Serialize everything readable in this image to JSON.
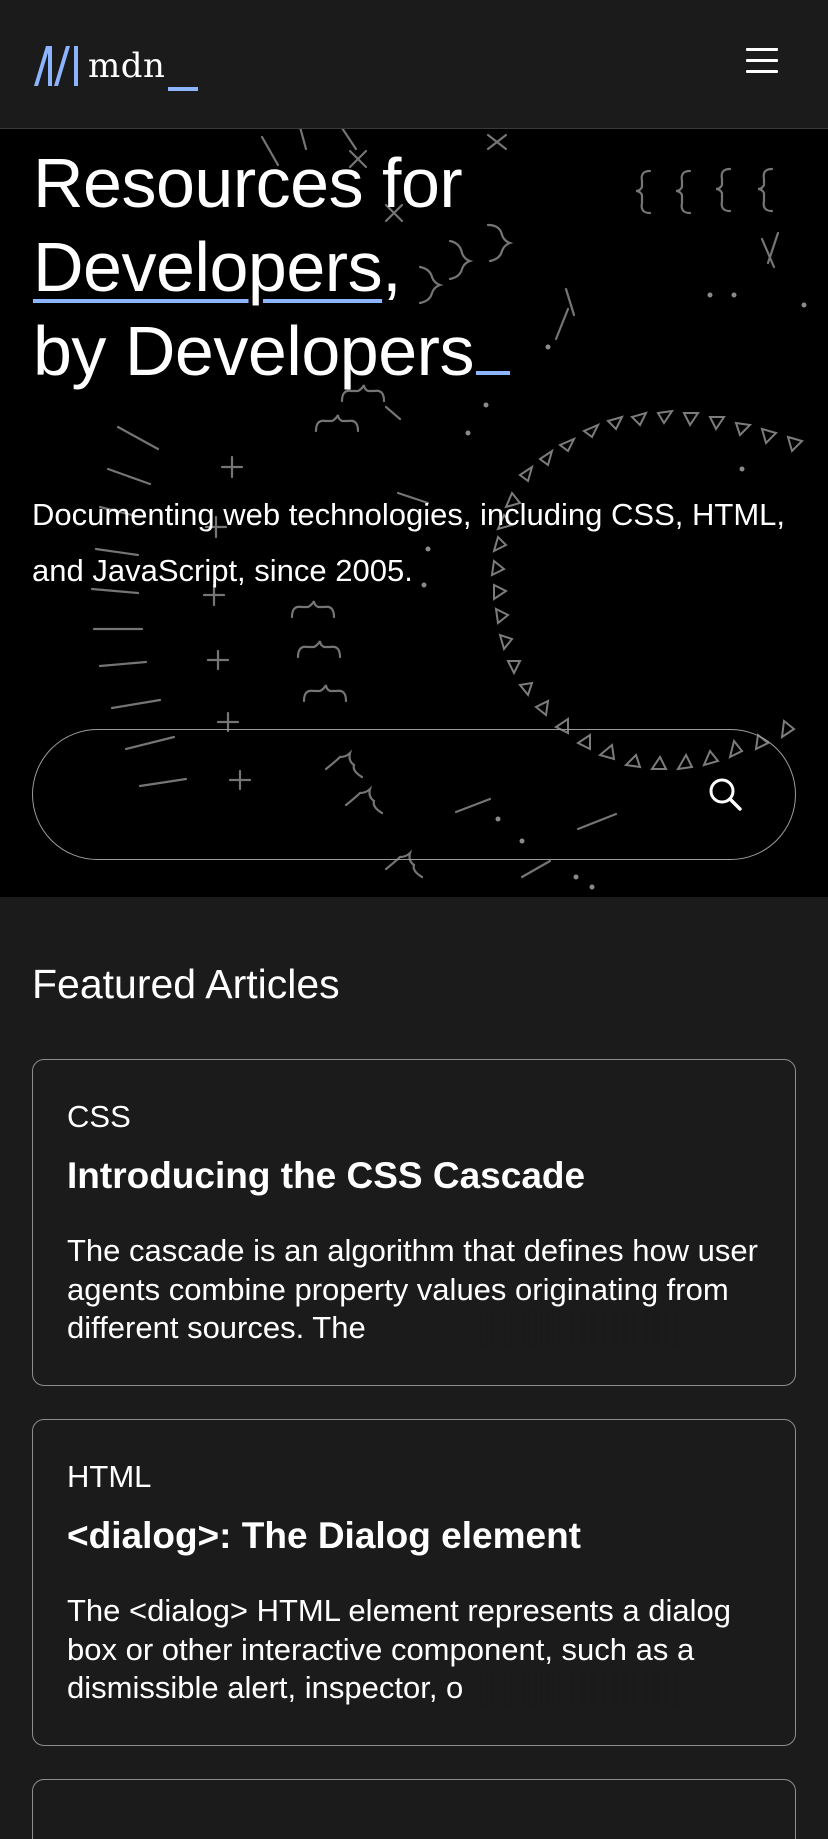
{
  "header": {
    "logo_text": "mdn",
    "menu_icon": "hamburger-menu-icon"
  },
  "hero": {
    "title_line1": "Resources for",
    "title_line2_underlined": "Developers",
    "title_line2_suffix": ",",
    "title_line3": "by Developers",
    "subtitle": "Documenting web technologies, including CSS, HTML, and JavaScript, since 2005.",
    "search": {
      "placeholder": "",
      "value": "",
      "icon": "search-icon"
    }
  },
  "featured": {
    "heading": "Featured Articles",
    "articles": [
      {
        "tag": "CSS",
        "title": "Introducing the CSS Cascade",
        "summary": "The cascade is an algorithm that defines how user agents combine property values originating from different sources. The"
      },
      {
        "tag": "HTML",
        "title": "<dialog>: The Dialog element",
        "summary": "The <dialog> HTML element represents a dialog box or other interactive component, such as a dismissible alert, inspector, o"
      }
    ]
  },
  "colors": {
    "accent": "#8cb4ff",
    "page_bg": "#1b1b1b",
    "hero_bg": "#000000",
    "card_border": "#8e8e8e"
  }
}
